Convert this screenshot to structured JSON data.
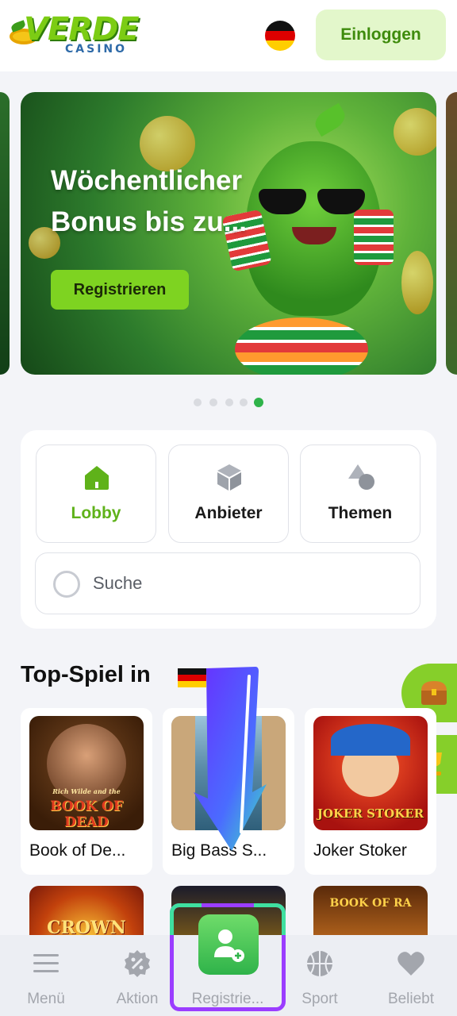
{
  "header": {
    "logo_main": "VERDE",
    "logo_sub": "CASINO",
    "login_label": "Einloggen",
    "language": "German"
  },
  "banner": {
    "title_line1": "Wöchentlicher",
    "title_line2": "Bonus bis zu...",
    "button_label": "Registrieren",
    "slide_count": 5,
    "active_slide": 5
  },
  "nav_tiles": [
    {
      "label": "Lobby",
      "icon": "home-icon",
      "active": true
    },
    {
      "label": "Anbieter",
      "icon": "cube-icon",
      "active": false
    },
    {
      "label": "Themen",
      "icon": "shapes-icon",
      "active": false
    }
  ],
  "search": {
    "placeholder": "Suche"
  },
  "top_games": {
    "title": "Top-Spiel in",
    "flag": "Germany",
    "games": [
      {
        "name": "Book of De...",
        "thumb_label_top": "Rich Wilde and the",
        "thumb_label": "BOOK OF DEAD"
      },
      {
        "name": "Big Bass S...",
        "thumb_label": ""
      },
      {
        "name": "Joker Stoker",
        "thumb_label": "JOKER STOKER"
      }
    ],
    "second_row": [
      {
        "thumb_label": "CROWN"
      },
      {
        "thumb_label": ""
      },
      {
        "thumb_label": "BOOK OF RA"
      }
    ]
  },
  "side_buttons": [
    {
      "icon": "treasure-chest-icon"
    },
    {
      "icon": "trophy-icon"
    }
  ],
  "bottom_nav": [
    {
      "label": "Menü",
      "icon": "hamburger-menu-icon"
    },
    {
      "label": "Aktion",
      "icon": "discount-badge-icon"
    },
    {
      "label": "Registrie...",
      "icon": "add-user-icon"
    },
    {
      "label": "Sport",
      "icon": "basketball-icon"
    },
    {
      "label": "Beliebt",
      "icon": "heart-icon"
    }
  ],
  "colors": {
    "brand_green": "#7ed321",
    "active_green": "#5fb21a",
    "login_bg": "#e3f7cb",
    "highlight_purple": "#9b3dff",
    "highlight_teal": "#3fe0a0"
  }
}
